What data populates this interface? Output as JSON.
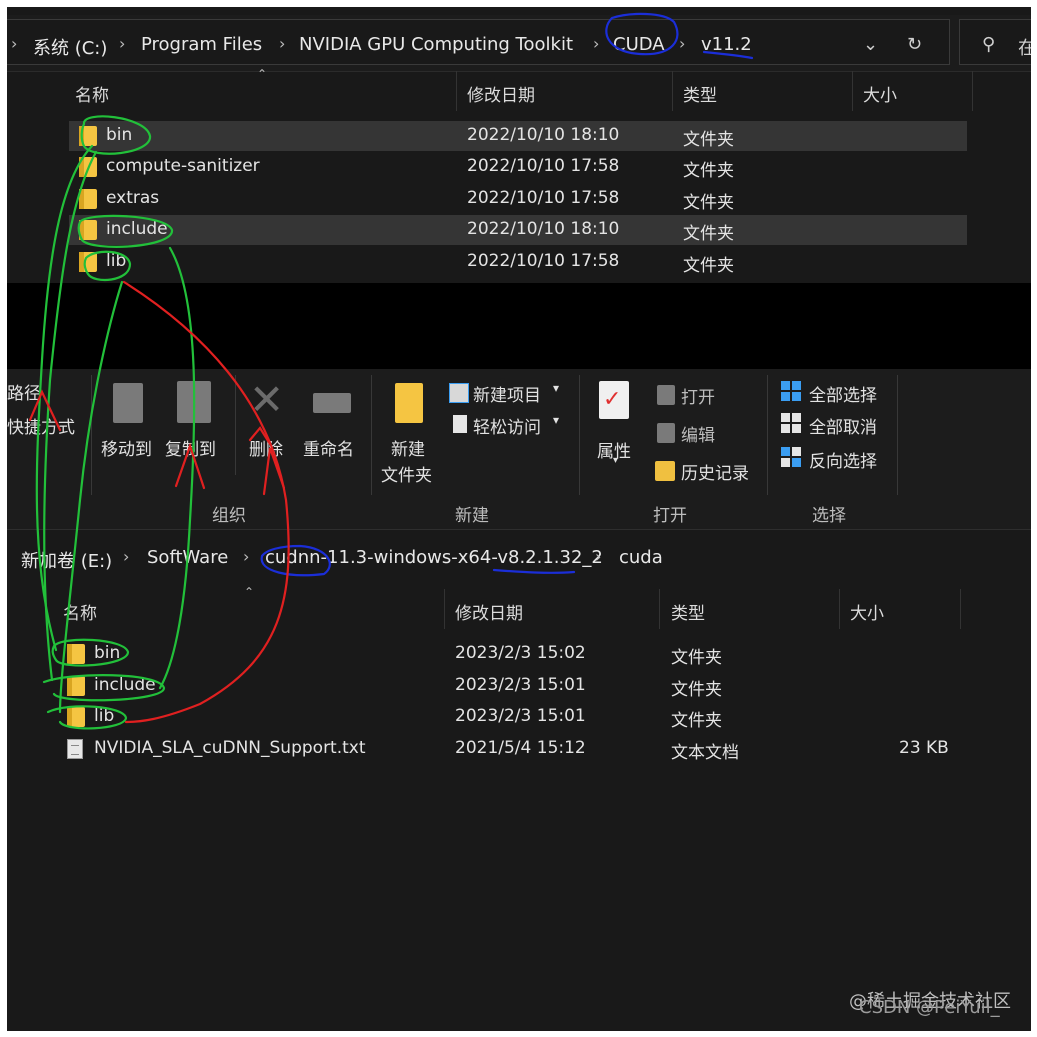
{
  "top_window": {
    "breadcrumbs": [
      "系统 (C:)",
      "Program Files",
      "NVIDIA GPU Computing Toolkit",
      "CUDA",
      "v11.2"
    ],
    "search_placeholder": "在",
    "columns": [
      "名称",
      "修改日期",
      "类型",
      "大小"
    ],
    "rows": [
      {
        "name": "bin",
        "date": "2022/10/10 18:10",
        "type": "文件夹",
        "size": "",
        "selected": true
      },
      {
        "name": "compute-sanitizer",
        "date": "2022/10/10 17:58",
        "type": "文件夹",
        "size": "",
        "selected": false
      },
      {
        "name": "extras",
        "date": "2022/10/10 17:58",
        "type": "文件夹",
        "size": "",
        "selected": false
      },
      {
        "name": "include",
        "date": "2022/10/10 18:10",
        "type": "文件夹",
        "size": "",
        "selected": true
      },
      {
        "name": "lib",
        "date": "2022/10/10 17:58",
        "type": "文件夹",
        "size": "",
        "selected": false
      }
    ]
  },
  "ribbon": {
    "partial_left": [
      "路径",
      "快捷方式"
    ],
    "organize": {
      "move_to": "移动到",
      "copy_to": "复制到",
      "delete": "删除",
      "rename": "重命名",
      "group": "组织"
    },
    "new": {
      "new_folder_1": "新建",
      "new_folder_2": "文件夹",
      "new_item": "新建项目",
      "easy_access": "轻松访问",
      "group": "新建"
    },
    "open": {
      "properties": "属性",
      "open": "打开",
      "edit": "编辑",
      "history": "历史记录",
      "group": "打开"
    },
    "select": {
      "select_all": "全部选择",
      "select_none": "全部取消",
      "invert": "反向选择",
      "group": "选择"
    }
  },
  "bottom_window": {
    "breadcrumbs": [
      "新加卷 (E:)",
      "SoftWare",
      "cudnn-11.3-windows-x64-v8.2.1.32_2",
      "cuda"
    ],
    "columns": [
      "名称",
      "修改日期",
      "类型",
      "大小"
    ],
    "rows": [
      {
        "name": "bin",
        "date": "2023/2/3 15:02",
        "type": "文件夹",
        "size": ""
      },
      {
        "name": "include",
        "date": "2023/2/3 15:01",
        "type": "文件夹",
        "size": ""
      },
      {
        "name": "lib",
        "date": "2023/2/3 15:01",
        "type": "文件夹",
        "size": ""
      },
      {
        "name": "NVIDIA_SLA_cuDNN_Support.txt",
        "date": "2021/5/4 15:12",
        "type": "文本文档",
        "size": "23 KB"
      }
    ]
  },
  "watermark": {
    "line1": "@稀土掘金技术社区",
    "line2": "CSDN @PeiYuil_"
  },
  "colors": {
    "annotation_green": "#22c03a",
    "annotation_red": "#e02020",
    "annotation_blue": "#1b2ed8",
    "folder": "#f5c542"
  }
}
